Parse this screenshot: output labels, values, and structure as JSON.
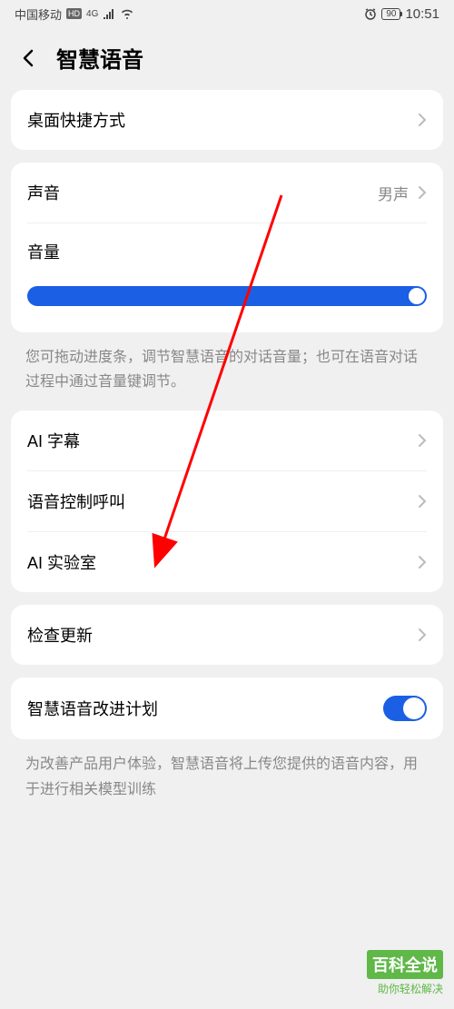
{
  "status": {
    "carrier": "中国移动",
    "hd": "HD",
    "network": "4G",
    "battery": "90",
    "time": "10:51"
  },
  "header": {
    "title": "智慧语音"
  },
  "group1": {
    "shortcut": "桌面快捷方式"
  },
  "group2": {
    "sound_label": "声音",
    "sound_value": "男声",
    "volume_label": "音量"
  },
  "volume_description": "您可拖动进度条，调节智慧语音的对话音量；也可在语音对话过程中通过音量键调节。",
  "group3": {
    "ai_subtitle": "AI 字幕",
    "voice_call": "语音控制呼叫",
    "ai_lab": "AI 实验室"
  },
  "group4": {
    "check_update": "检查更新"
  },
  "group5": {
    "improvement": "智慧语音改进计划"
  },
  "improvement_description": "为改善产品用户体验，智慧语音将上传您提供的语音内容，用于进行相关模型训练",
  "watermark": {
    "main": "百科全说",
    "sub": "助你轻松解决"
  }
}
